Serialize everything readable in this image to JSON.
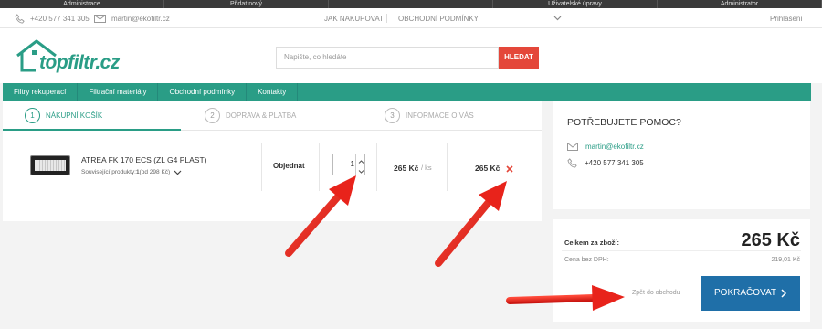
{
  "admin_bar": [
    "Administrace",
    "Přidat nový",
    "",
    "Uživatelské úpravy",
    "Administrator"
  ],
  "topbar": {
    "phone": "+420 577 341 305",
    "email": "martin@ekofiltr.cz",
    "how_to_buy": "JAK NAKUPOVAT",
    "terms": "OBCHODNÍ PODMÍNKY",
    "login": "Přihlášení"
  },
  "header": {
    "logo_text": "topfiltr.cz",
    "search_placeholder": "Napište, co hledáte",
    "search_button": "HLEDAT"
  },
  "nav": [
    "Filtry rekuperací",
    "Filtrační materiály",
    "Obchodní podmínky",
    "Kontakty"
  ],
  "steps": [
    {
      "num": "1",
      "label": "NÁKUPNÍ KOŠÍK"
    },
    {
      "num": "2",
      "label": "DOPRAVA & PLATBA"
    },
    {
      "num": "3",
      "label": "INFORMACE O VÁS"
    }
  ],
  "cart_item": {
    "name": "ATREA FK 170 ECS (ZL G4 PLAST)",
    "related_prefix": "Související produkty: ",
    "related_count": "1",
    "related_suffix": " (od 298 Kč)",
    "order_label": "Objednat",
    "quantity": "1",
    "unit_price": "265 Kč",
    "unit_per": "/ ks",
    "total_price": "265 Kč"
  },
  "help": {
    "title": "POTŘEBUJETE POMOC?",
    "email": "martin@ekofiltr.cz",
    "phone": "+420 577 341 305"
  },
  "summary": {
    "total_label": "Celkem za zboží:",
    "total_value": "265 Kč",
    "net_label": "Cena bez DPH:",
    "net_value": "219,01 Kč",
    "back_link": "Zpět do obchodu",
    "continue_button": "POKRAČOVAT"
  },
  "colors": {
    "brand_green": "#2a9d86",
    "search_red": "#e4473a",
    "continue_blue": "#1f6fa8",
    "arrow_red": "#e8231b"
  }
}
